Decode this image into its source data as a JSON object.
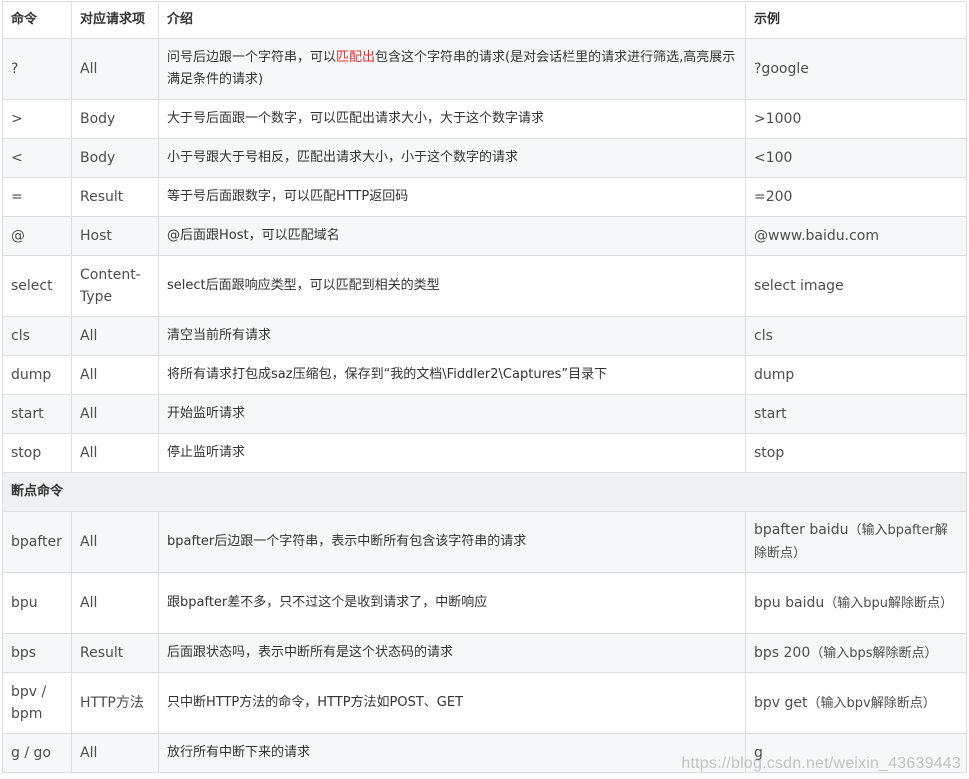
{
  "table": {
    "headers": [
      "命令",
      "对应请求项",
      "介绍",
      "示例"
    ],
    "rows": [
      {
        "cmd": "?",
        "item": "All",
        "desc_pre": "问号后边跟一个字符串，可以",
        "desc_hl": "匹配出",
        "desc_post": "包含这个字符串的请求(是对会话栏里的请求进行筛选,高亮展示满足条件的请求)",
        "example": "?google",
        "tall": true
      },
      {
        "cmd": ">",
        "item": "Body",
        "desc_pre": "大于号后面跟一个数字，可以匹配出请求大小，大于这个数字请求",
        "example": ">1000"
      },
      {
        "cmd": "<",
        "item": "Body",
        "desc_pre": "小于号跟大于号相反，匹配出请求大小，小于这个数字的请求",
        "example": "<100"
      },
      {
        "cmd": "=",
        "item": "Result",
        "desc_pre": "等于号后面跟数字，可以匹配HTTP返回码",
        "example": "=200"
      },
      {
        "cmd": "@",
        "item": "Host",
        "desc_pre": "@后面跟Host，可以匹配域名",
        "example": "@www.baidu.com"
      },
      {
        "cmd": "select",
        "item": "Content-Type",
        "desc_pre": "select后面跟响应类型，可以匹配到相关的类型",
        "example": "select image",
        "tall": true
      },
      {
        "cmd": "cls",
        "item": "All",
        "desc_pre": "清空当前所有请求",
        "example": "cls"
      },
      {
        "cmd": "dump",
        "item": "All",
        "desc_pre": "将所有请求打包成saz压缩包，保存到“我的文档\\Fiddler2\\Captures”目录下",
        "example": "dump"
      },
      {
        "cmd": "start",
        "item": "All",
        "desc_pre": "开始监听请求",
        "example": "start"
      },
      {
        "cmd": "stop",
        "item": "All",
        "desc_pre": "停止监听请求",
        "example": "stop"
      }
    ],
    "section_label": "断点命令",
    "breakpoint_rows": [
      {
        "cmd": "bpafter",
        "item": "All",
        "desc_pre": "bpafter后边跟一个字符串，表示中断所有包含该字符串的请求",
        "example": "bpafter baidu",
        "example_note": "（输入bpafter解除断点）",
        "tall": true
      },
      {
        "cmd": "bpu",
        "item": "All",
        "desc_pre": "跟bpafter差不多，只不过这个是收到请求了，中断响应",
        "example": "bpu baidu",
        "example_note": "（输入bpu解除断点）",
        "tall": true
      },
      {
        "cmd": "bps",
        "item": "Result",
        "desc_pre": "后面跟状态吗，表示中断所有是这个状态码的请求",
        "example": "bps 200",
        "example_note": "（输入bps解除断点）"
      },
      {
        "cmd": "bpv / bpm",
        "item": "HTTP方法",
        "desc_pre": "只中断HTTP方法的命令，HTTP方法如POST、GET",
        "example": "bpv get",
        "example_note": "（输入bpv解除断点）",
        "tall": true
      },
      {
        "cmd": "g / go",
        "item": "All",
        "desc_pre": "放行所有中断下来的请求",
        "example": "g"
      }
    ]
  },
  "watermark": "https://blog.csdn.net/weixin_43639443"
}
